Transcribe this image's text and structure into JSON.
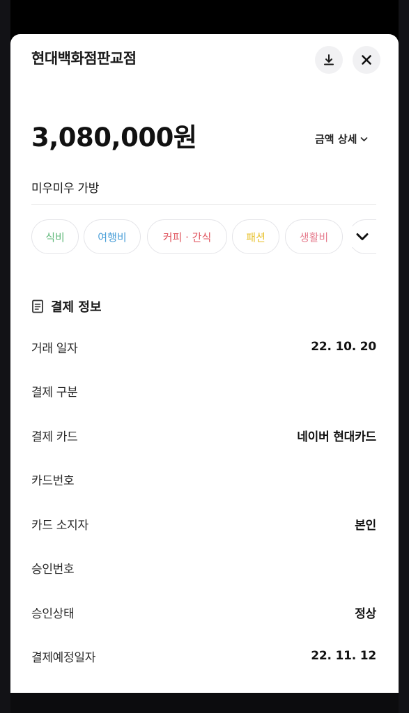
{
  "header": {
    "merchant": "현대백화점판교점",
    "download_icon": "download-icon",
    "close_icon": "close-icon"
  },
  "amount": {
    "value": "3,080,000원",
    "detail_label": "금액 상세"
  },
  "memo": "미우미우 가방",
  "categories": [
    {
      "label": "식비",
      "color": "#5fb87a"
    },
    {
      "label": "여행비",
      "color": "#4a9fd8"
    },
    {
      "label": "커피 · 간식",
      "color": "#e0555f"
    },
    {
      "label": "패션",
      "color": "#e8c230"
    },
    {
      "label": "생활비",
      "color": "#e67e8f"
    }
  ],
  "payment_info": {
    "title": "결제 정보",
    "rows": [
      {
        "label": "거래 일자",
        "value": "22. 10. 20"
      },
      {
        "label": "결제 구분",
        "value": ""
      },
      {
        "label": "결제 카드",
        "value": "네이버 현대카드"
      },
      {
        "label": "카드번호",
        "value": ""
      },
      {
        "label": "카드 소지자",
        "value": "본인"
      },
      {
        "label": "승인번호",
        "value": ""
      },
      {
        "label": "승인상태",
        "value": "정상"
      },
      {
        "label": "결제예정일자",
        "value": "22. 11. 12"
      }
    ]
  }
}
